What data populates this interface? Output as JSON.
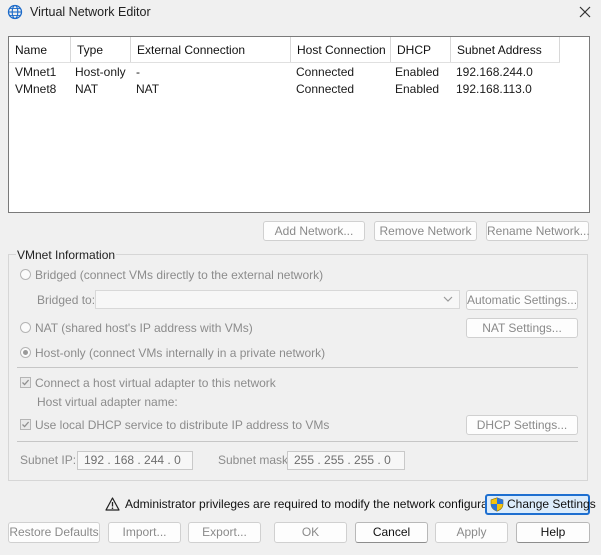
{
  "window": {
    "title": "Virtual Network Editor"
  },
  "table": {
    "headers": [
      "Name",
      "Type",
      "External Connection",
      "Host Connection",
      "DHCP",
      "Subnet Address"
    ],
    "rows": [
      [
        "VMnet1",
        "Host-only",
        "-",
        "Connected",
        "Enabled",
        "192.168.244.0"
      ],
      [
        "VMnet8",
        "NAT",
        "NAT",
        "Connected",
        "Enabled",
        "192.168.113.0"
      ]
    ]
  },
  "network_buttons": {
    "add": "Add Network...",
    "remove": "Remove Network",
    "rename": "Rename Network..."
  },
  "vmnet_info": {
    "group_label": "VMnet Information",
    "bridged_label": "Bridged (connect VMs directly to the external network)",
    "bridged_to_label": "Bridged to:",
    "bridged_to_value": "",
    "automatic_settings": "Automatic Settings...",
    "nat_label": "NAT (shared host's IP address with VMs)",
    "nat_settings": "NAT Settings...",
    "host_only_label": "Host-only (connect VMs internally in a private network)",
    "selected_mode": "Host-only",
    "connect_adapter_label": "Connect a host virtual adapter to this network",
    "connect_adapter_checked": true,
    "adapter_name_label": "Host virtual adapter name:",
    "adapter_name_value": "",
    "dhcp_label": "Use local DHCP service to distribute IP address to VMs",
    "dhcp_checked": true,
    "dhcp_settings": "DHCP Settings...",
    "subnet_ip_label": "Subnet IP:",
    "subnet_ip_value": "192 . 168 . 244 .  0",
    "subnet_mask_label": "Subnet mask:",
    "subnet_mask_value": "255 . 255 . 255 .  0"
  },
  "admin": {
    "warning": "Administrator privileges are required to modify the network configuration.",
    "change_settings": "Change Settings"
  },
  "footer": {
    "restore_defaults": "Restore Defaults",
    "import": "Import...",
    "export": "Export...",
    "ok": "OK",
    "cancel": "Cancel",
    "apply": "Apply",
    "help": "Help"
  },
  "icons": [
    "globe-icon",
    "close-icon",
    "chevron-down-icon",
    "warning-icon",
    "shield-icon"
  ],
  "colors": {
    "accent": "#1e6fd0",
    "disabled_text": "#8c8c8c"
  }
}
